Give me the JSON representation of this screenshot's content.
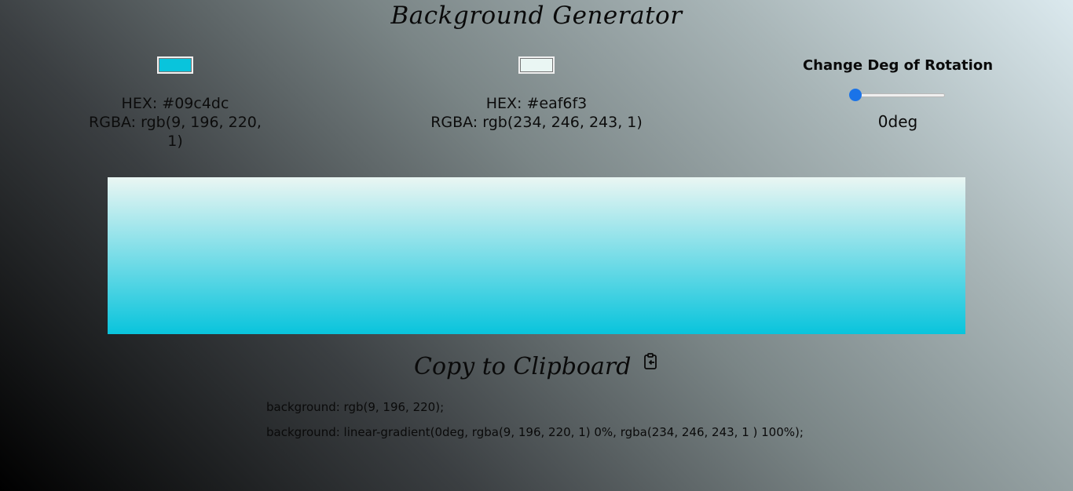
{
  "title": "Background Generator",
  "color1": {
    "value": "#09c4dc",
    "hex_text": "HEX: #09c4dc",
    "rgba_text": "RGBA: rgb(9, 196, 220, 1)"
  },
  "color2": {
    "value": "#eaf6f3",
    "hex_text": "HEX: #eaf6f3",
    "rgba_text": "RGBA: rgb(234, 246, 243, 1)"
  },
  "rotation": {
    "label": "Change Deg of Rotation",
    "value": 0,
    "min": 0,
    "max": 360,
    "value_text": "0deg"
  },
  "copy": {
    "label": "Copy to Clipboard",
    "icon": "clipboard-copy-icon",
    "code_line_1": "background: rgb(9, 196, 220);",
    "code_line_2": "background: linear-gradient(0deg, rgba(9, 196, 220, 1) 0%, rgba(234, 246, 243, 1 ) 100%);"
  }
}
